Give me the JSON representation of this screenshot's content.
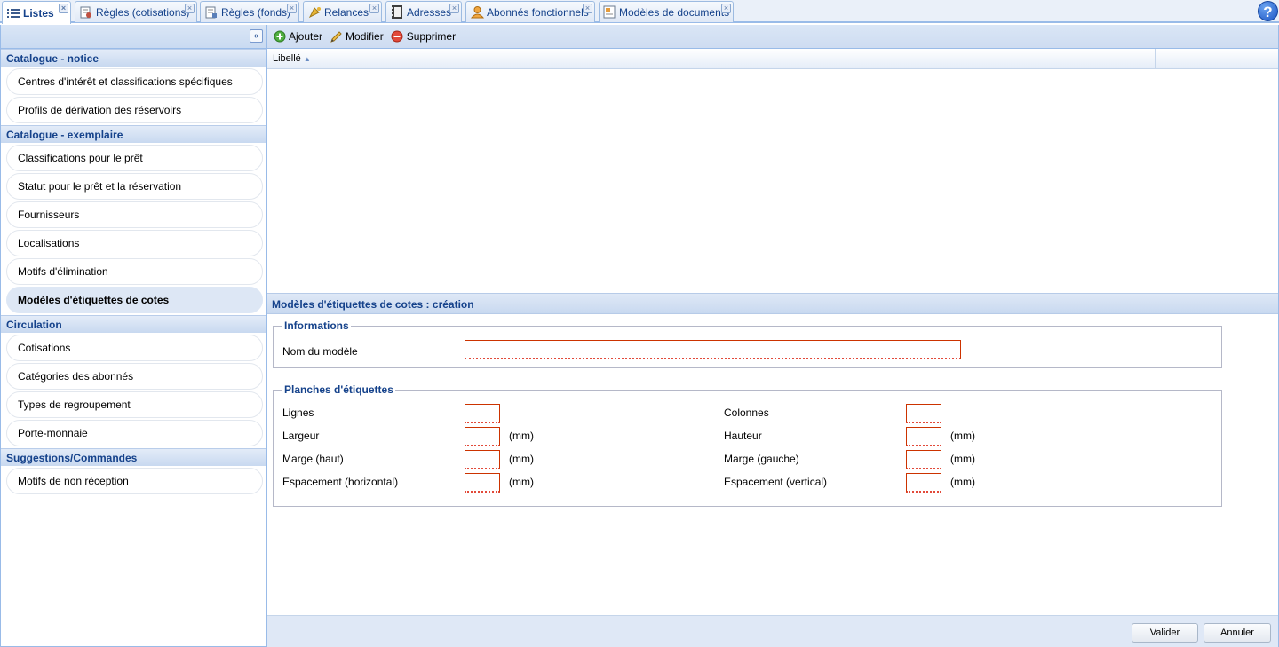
{
  "tabs": [
    {
      "label": "Listes",
      "icon": "list-icon",
      "active": true
    },
    {
      "label": "Règles (cotisations)",
      "icon": "rules-icon",
      "active": false
    },
    {
      "label": "Règles (fonds)",
      "icon": "rules-fund-icon",
      "active": false
    },
    {
      "label": "Relances",
      "icon": "reminder-icon",
      "active": false
    },
    {
      "label": "Adresses",
      "icon": "address-book-icon",
      "active": false
    },
    {
      "label": "Abonnés fonctionnels",
      "icon": "user-icon",
      "active": false
    },
    {
      "label": "Modèles de documents",
      "icon": "document-template-icon",
      "active": false
    }
  ],
  "help_label": "?",
  "sidebar": {
    "collapse_label": "«",
    "sections": [
      {
        "title": "Catalogue - notice",
        "items": [
          "Centres d'intérêt et classifications spécifiques",
          "Profils de dérivation des réservoirs"
        ]
      },
      {
        "title": "Catalogue - exemplaire",
        "items": [
          "Classifications pour le prêt",
          "Statut pour le prêt et la réservation",
          "Fournisseurs",
          "Localisations",
          "Motifs d'élimination",
          "Modèles d'étiquettes de cotes"
        ]
      },
      {
        "title": "Circulation",
        "items": [
          "Cotisations",
          "Catégories des abonnés",
          "Types de regroupement",
          "Porte-monnaie"
        ]
      },
      {
        "title": "Suggestions/Commandes",
        "items": [
          "Motifs de non réception"
        ]
      }
    ],
    "selected_item": "Modèles d'étiquettes de cotes"
  },
  "toolbar": {
    "add_label": "Ajouter",
    "edit_label": "Modifier",
    "delete_label": "Supprimer"
  },
  "grid": {
    "column_label": "Libellé",
    "sort_glyph": "▲"
  },
  "form": {
    "title": "Modèles d'étiquettes de cotes : création",
    "info_legend": "Informations",
    "name_label": "Nom du modèle",
    "name_value": "",
    "sheets_legend": "Planches d'étiquettes",
    "rows_label": "Lignes",
    "columns_label": "Colonnes",
    "width_label": "Largeur",
    "height_label": "Hauteur",
    "margin_top_label": "Marge (haut)",
    "margin_left_label": "Marge (gauche)",
    "spacing_h_label": "Espacement (horizontal)",
    "spacing_v_label": "Espacement (vertical)",
    "unit": "(mm)"
  },
  "footer": {
    "validate_label": "Valider",
    "cancel_label": "Annuler"
  }
}
